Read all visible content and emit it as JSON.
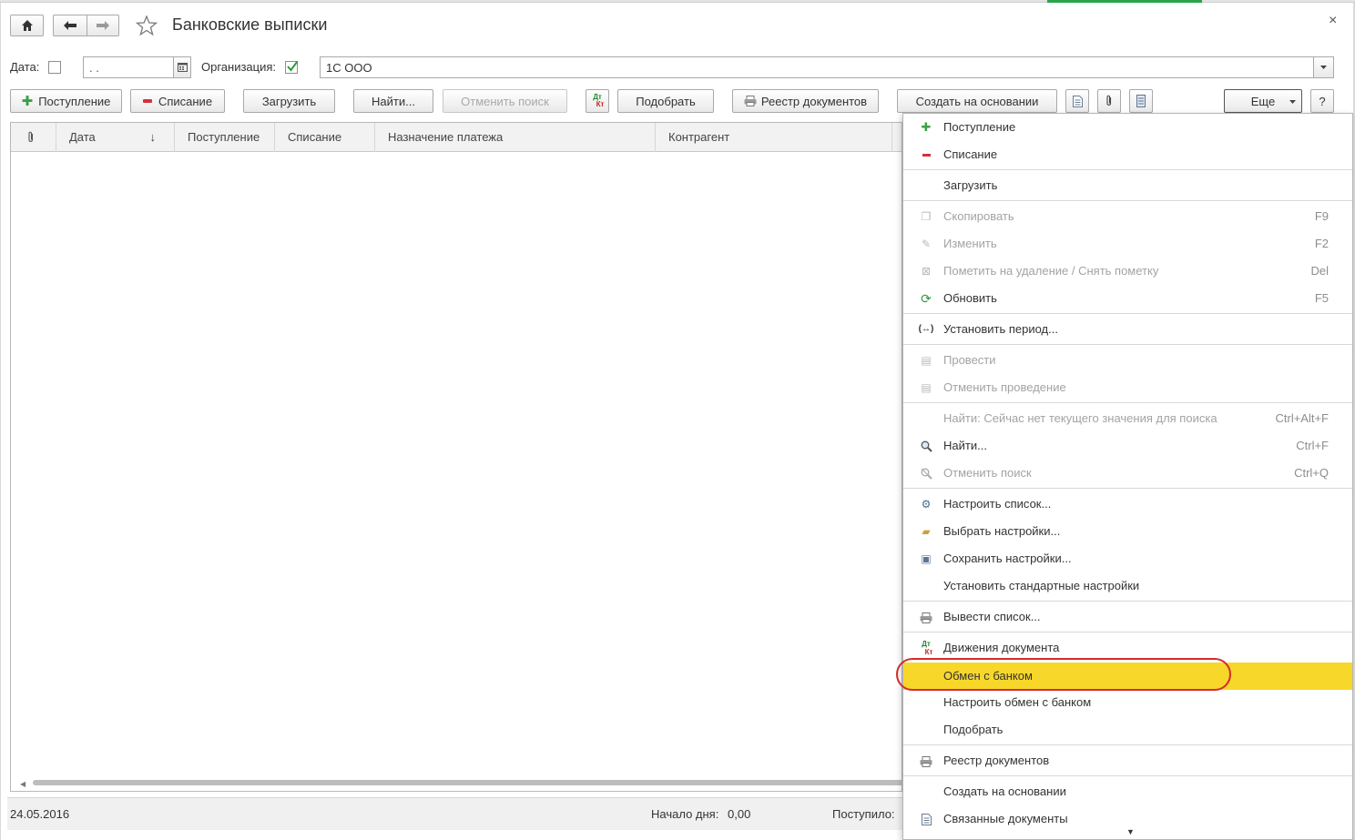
{
  "window": {
    "title": "Банковские выписки",
    "close_glyph": "×"
  },
  "nav": {
    "home_icon": "home-icon",
    "back_icon": "arrow-left-icon",
    "forward_icon": "arrow-right-icon",
    "star_icon": "star-icon"
  },
  "filters": {
    "date_label": "Дата:",
    "date_value": " .  .",
    "org_label": "Организация:",
    "org_checked": true,
    "org_value": "1С ООО"
  },
  "toolbar": {
    "receipt": "Поступление",
    "writeoff": "Списание",
    "load": "Загрузить",
    "find": "Найти...",
    "cancel_search": "Отменить поиск",
    "dtkt_top": "Дт",
    "dtkt_bottom": "Кт",
    "select": "Подобрать",
    "registry": "Реестр документов",
    "create_based": "Создать на основании",
    "more": "Еще",
    "help": "?"
  },
  "table": {
    "columns": [
      "Дата",
      "Поступление",
      "Списание",
      "Назначение платежа",
      "Контрагент"
    ],
    "sort_indicator": "↓",
    "rows": []
  },
  "status": {
    "date": "24.05.2016",
    "day_start_label": "Начало дня:",
    "day_start_value": "0,00",
    "received_label": "Поступило:"
  },
  "menu": {
    "items": [
      {
        "label": "Поступление",
        "key": "",
        "icon": "plus-icon",
        "disabled": false,
        "highlighted": false
      },
      {
        "label": "Списание",
        "key": "",
        "icon": "minus-icon",
        "disabled": false,
        "highlighted": false
      },
      {
        "label": "Загрузить",
        "key": "",
        "icon": "",
        "disabled": false,
        "highlighted": false
      },
      {
        "label": "Скопировать",
        "key": "F9",
        "icon": "copy-icon",
        "disabled": true,
        "highlighted": false
      },
      {
        "label": "Изменить",
        "key": "F2",
        "icon": "pencil-icon",
        "disabled": true,
        "highlighted": false
      },
      {
        "label": "Пометить на удаление / Снять пометку",
        "key": "Del",
        "icon": "delete-mark-icon",
        "disabled": true,
        "highlighted": false
      },
      {
        "label": "Обновить",
        "key": "F5",
        "icon": "refresh-icon",
        "disabled": false,
        "highlighted": false
      },
      {
        "label": "Установить период...",
        "key": "",
        "icon": "period-icon",
        "disabled": false,
        "highlighted": false
      },
      {
        "label": "Провести",
        "key": "",
        "icon": "post-icon",
        "disabled": true,
        "highlighted": false
      },
      {
        "label": "Отменить проведение",
        "key": "",
        "icon": "unpost-icon",
        "disabled": true,
        "highlighted": false
      },
      {
        "label": "Найти: Сейчас нет текущего значения для поиска",
        "key": "Ctrl+Alt+F",
        "icon": "",
        "disabled": true,
        "highlighted": false
      },
      {
        "label": "Найти...",
        "key": "Ctrl+F",
        "icon": "search-icon",
        "disabled": false,
        "highlighted": false
      },
      {
        "label": "Отменить поиск",
        "key": "Ctrl+Q",
        "icon": "cancel-search-icon",
        "disabled": true,
        "highlighted": false
      },
      {
        "label": "Настроить список...",
        "key": "",
        "icon": "list-settings-icon",
        "disabled": false,
        "highlighted": false
      },
      {
        "label": "Выбрать настройки...",
        "key": "",
        "icon": "folder-settings-icon",
        "disabled": false,
        "highlighted": false
      },
      {
        "label": "Сохранить настройки...",
        "key": "",
        "icon": "save-settings-icon",
        "disabled": false,
        "highlighted": false
      },
      {
        "label": "Установить стандартные настройки",
        "key": "",
        "icon": "",
        "disabled": false,
        "highlighted": false
      },
      {
        "label": "Вывести список...",
        "key": "",
        "icon": "print-list-icon",
        "disabled": false,
        "highlighted": false
      },
      {
        "label": "Движения документа",
        "key": "",
        "icon": "dtkt-icon",
        "disabled": false,
        "highlighted": false
      },
      {
        "label": "Обмен с банком",
        "key": "",
        "icon": "",
        "disabled": false,
        "highlighted": true
      },
      {
        "label": "Настроить обмен с банком",
        "key": "",
        "icon": "",
        "disabled": false,
        "highlighted": false
      },
      {
        "label": "Подобрать",
        "key": "",
        "icon": "",
        "disabled": false,
        "highlighted": false
      },
      {
        "label": "Реестр документов",
        "key": "",
        "icon": "printer-icon",
        "disabled": false,
        "highlighted": false
      },
      {
        "label": "Создать на основании",
        "key": "",
        "icon": "",
        "disabled": false,
        "highlighted": false
      },
      {
        "label": "Связанные документы",
        "key": "",
        "icon": "related-docs-icon",
        "disabled": false,
        "highlighted": false
      }
    ],
    "more_glyph": "▼"
  },
  "colors": {
    "highlight": "#f7d72a",
    "annotation_oval": "#d42b2b",
    "accent_green": "#2aa44a"
  }
}
